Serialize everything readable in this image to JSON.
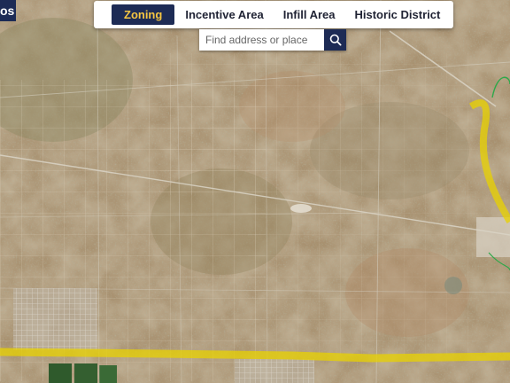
{
  "app": {
    "logo_text": "os"
  },
  "layers": {
    "tabs": [
      {
        "label": "Zoning",
        "active": true
      },
      {
        "label": "Incentive Area",
        "active": false
      },
      {
        "label": "Infill Area",
        "active": false
      },
      {
        "label": "Historic District",
        "active": false
      }
    ]
  },
  "search": {
    "placeholder": "Find address or place",
    "value": ""
  },
  "colors": {
    "brand_navy": "#1d2b55",
    "active_tab_text": "#f5c542",
    "boundary_highlight": "#e8d100",
    "green_boundary": "#2ea84a"
  },
  "icons": [
    "search-icon"
  ],
  "map": {
    "type": "satellite-imagery"
  }
}
